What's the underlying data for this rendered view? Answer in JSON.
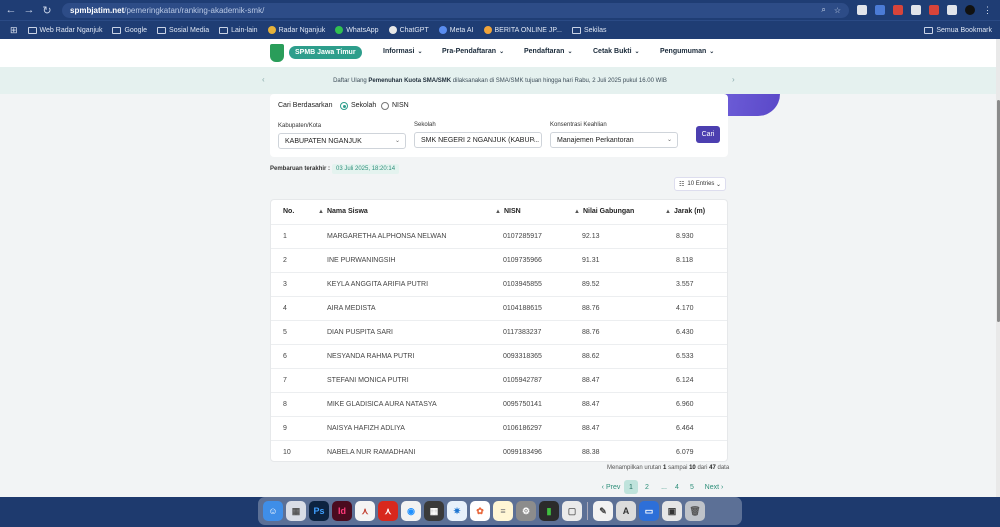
{
  "browser": {
    "url_host": "spmbjatim.net",
    "url_path": "/pemeringkatan/ranking-akademik-smk/",
    "bookmarks": [
      "Web Radar Nganjuk",
      "Google",
      "Sosial Media",
      "Lain-lain",
      "Radar Nganjuk",
      "WhatsApp",
      "ChatGPT",
      "Meta AI",
      "BERITA ONLINE JP...",
      "Sekilas"
    ],
    "all_bookmarks": "Semua Bookmark"
  },
  "header": {
    "logo_text": "SPMB Jawa Timur",
    "menu": [
      "Informasi",
      "Pra-Pendaftaran",
      "Pendaftaran",
      "Cetak Bukti",
      "Pengumuman"
    ]
  },
  "announcement": {
    "pre": "Daftar Ulang",
    "bold": "Pemenuhan Kuota SMA/SMK",
    "post": "dilaksanakan di SMA/SMK tujuan hingga hari Rabu, 2 Juli 2025 pukul 16.00 WIB"
  },
  "filter": {
    "search_by_label": "Cari Berdasarkan",
    "options": [
      "Sekolah",
      "NISN"
    ],
    "selected": "Sekolah",
    "kabupaten_label": "Kabupaten/Kota",
    "kabupaten_value": "KABUPATEN NGANJUK",
    "sekolah_label": "Sekolah",
    "sekolah_value": "SMK NEGERI 2 NGANJUK (KABUP...",
    "konsentrasi_label": "Konsentrasi Keahlian",
    "konsentrasi_value": "Manajemen Perkantoran",
    "search_button": "Cari"
  },
  "update": {
    "label": "Pembaruan terakhir :",
    "value": "03 Juli 2025, 18:20:14"
  },
  "entries": "10 Entries",
  "table": {
    "headers": [
      "No.",
      "Nama Siswa",
      "NISN",
      "Nilai Gabungan",
      "Jarak (m)"
    ],
    "rows": [
      [
        "1",
        "MARGARETHA ALPHONSA NELWAN",
        "0107285917",
        "92.13",
        "8.930"
      ],
      [
        "2",
        "INE PURWANINGSIH",
        "0109735966",
        "91.31",
        "8.118"
      ],
      [
        "3",
        "KEYLA ANGGITA ARIFIA PUTRI",
        "0103945855",
        "89.52",
        "3.557"
      ],
      [
        "4",
        "AIRA MEDISTA",
        "0104188615",
        "88.76",
        "4.170"
      ],
      [
        "5",
        "DIAN PUSPITA SARI",
        "0117383237",
        "88.76",
        "6.430"
      ],
      [
        "6",
        "NESYANDA RAHMA PUTRI",
        "0093318365",
        "88.62",
        "6.533"
      ],
      [
        "7",
        "STEFANI MONICA PUTRI",
        "0105942787",
        "88.47",
        "6.124"
      ],
      [
        "8",
        "MIKE GLADISICA AURA NATASYA",
        "0095750141",
        "88.47",
        "6.960"
      ],
      [
        "9",
        "NAISYA HAFIZH ADLIYA",
        "0106186297",
        "88.47",
        "6.464"
      ],
      [
        "10",
        "NABELA NUR RAMADHANI",
        "0099183496",
        "88.38",
        "6.079"
      ]
    ]
  },
  "summary": {
    "pre": "Menampilkan urutan",
    "from": "1",
    "mid1": "sampai",
    "to": "10",
    "mid2": "dari",
    "total": "47",
    "post": "data"
  },
  "pagination": {
    "prev": "Prev",
    "pages": [
      "1",
      "2",
      "...",
      "4",
      "5"
    ],
    "current": "1",
    "next": "Next"
  },
  "dock_apps": [
    "finder-icon",
    "launchpad-icon",
    "photoshop-icon",
    "indesign-icon",
    "acrobat-icon",
    "acrobat-reader-icon",
    "chrome-icon",
    "calculator-icon",
    "safari-icon",
    "photos-icon",
    "notes-icon",
    "system-settings-icon",
    "battery-app-icon",
    "preview-icon",
    "textedit-icon",
    "font-book-icon",
    "keynote-icon",
    "screenshot-icon",
    "trash-icon"
  ]
}
